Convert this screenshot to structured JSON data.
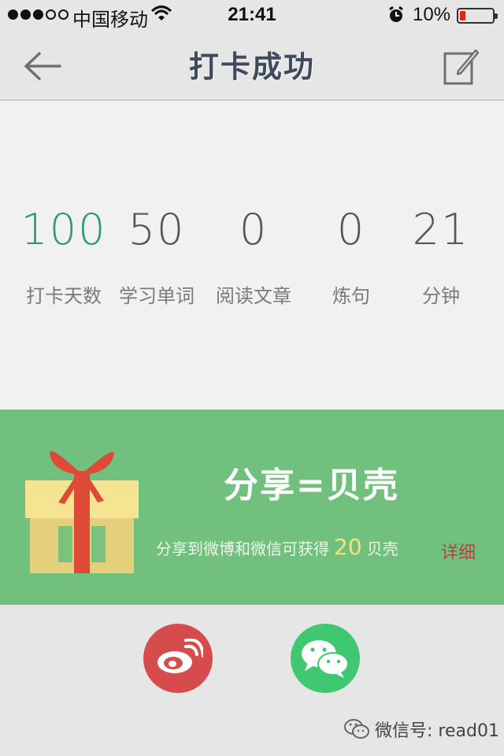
{
  "status_bar": {
    "carrier": "中国移动",
    "time": "21:41",
    "battery": "10%",
    "battery_level": 0.1,
    "signal_bars": 3
  },
  "nav": {
    "title": "打卡成功",
    "back_icon": "arrow-left-icon",
    "edit_icon": "edit-note-icon"
  },
  "stats": [
    {
      "value": "100",
      "label": "打卡天数"
    },
    {
      "value": "50",
      "label": "学习单词"
    },
    {
      "value": "0",
      "label": "阅读文章"
    },
    {
      "value": "0",
      "label": "炼句"
    },
    {
      "value": "21",
      "label": "分钟"
    }
  ],
  "share": {
    "title": "分享=贝壳",
    "desc_prefix": "分享到微博和微信可获得",
    "reward": "20",
    "desc_suffix": "贝壳",
    "details": "详细"
  },
  "buttons": {
    "weibo_icon": "weibo-icon",
    "wechat_icon": "wechat-icon"
  },
  "watermark": {
    "text": "微信号: read01"
  },
  "colors": {
    "accent_green": "#2f9a72",
    "banner_green": "#72c07d",
    "weibo_red": "#d64c4c",
    "wechat_green": "#3fc772",
    "reward_yellow": "#f3e27d",
    "details_red": "#b0443a"
  }
}
